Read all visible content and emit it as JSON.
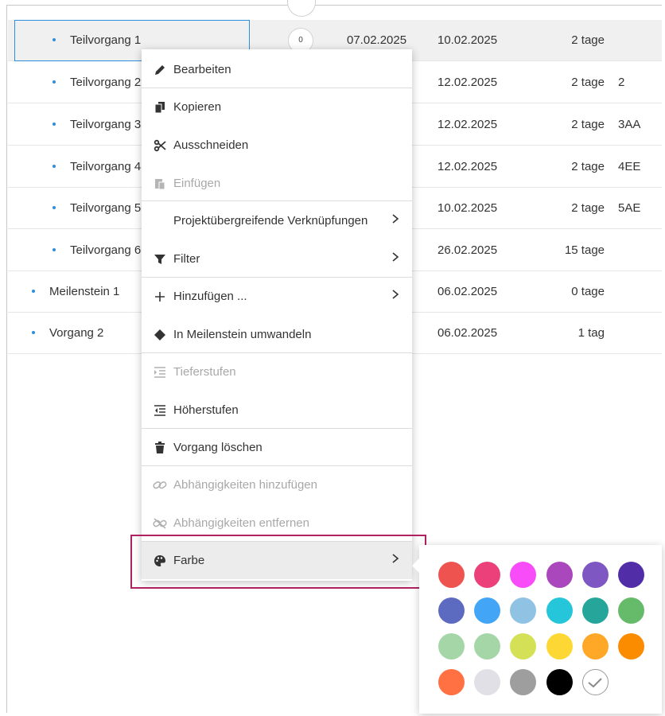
{
  "rows": [
    {
      "name": "Teilvorgang 1",
      "badge": "0",
      "start": "07.02.2025",
      "end": "10.02.2025",
      "duration": "2 tage",
      "pred": ""
    },
    {
      "name": "Teilvorgang 2",
      "end": "12.02.2025",
      "duration": "2 tage",
      "pred": "2"
    },
    {
      "name": "Teilvorgang 3",
      "end": "12.02.2025",
      "duration": "2 tage",
      "pred": "3AA"
    },
    {
      "name": "Teilvorgang 4",
      "end": "12.02.2025",
      "duration": "2 tage",
      "pred": "4EE"
    },
    {
      "name": "Teilvorgang 5",
      "end": "10.02.2025",
      "duration": "2 tage",
      "pred": "5AE"
    },
    {
      "name": "Teilvorgang 6",
      "end": "26.02.2025",
      "duration": "15 tage",
      "pred": ""
    },
    {
      "name": "Meilenstein 1",
      "end": "06.02.2025",
      "duration": "0 tage",
      "pred": ""
    },
    {
      "name": "Vorgang 2",
      "end": "06.02.2025",
      "duration": "1 tag",
      "pred": ""
    }
  ],
  "menu": {
    "edit": "Bearbeiten",
    "copy": "Kopieren",
    "cut": "Ausschneiden",
    "paste": "Einfügen",
    "cross_project_links": "Projektübergreifende Verknüpfungen",
    "filter": "Filter",
    "add": "Hinzufügen ...",
    "convert_milestone": "In Meilenstein umwandeln",
    "indent": "Tieferstufen",
    "outdent": "Höherstufen",
    "delete": "Vorgang löschen",
    "add_dependencies": "Abhängigkeiten hinzufügen",
    "remove_dependencies": "Abhängigkeiten entfernen",
    "color": "Farbe"
  },
  "palette": {
    "colors": [
      "#ef5350",
      "#ec407a",
      "#f74cf7",
      "#ab47bc",
      "#7e57c2",
      "#512da8",
      "#5c6bc0",
      "#42a5f5",
      "#90c2e4",
      "#26c6da",
      "#26a69a",
      "#66bb6a",
      "#a5d6a7",
      "#a5d6a7",
      "#d4e157",
      "#fdd835",
      "#ffa726",
      "#fb8c00",
      "#ff7043",
      "#e0e0e6",
      "#9e9e9e",
      "#000000"
    ],
    "no_color_icon": "check-circle-icon"
  },
  "accent": "#2f8fdc",
  "highlight_border": "#b0215f"
}
